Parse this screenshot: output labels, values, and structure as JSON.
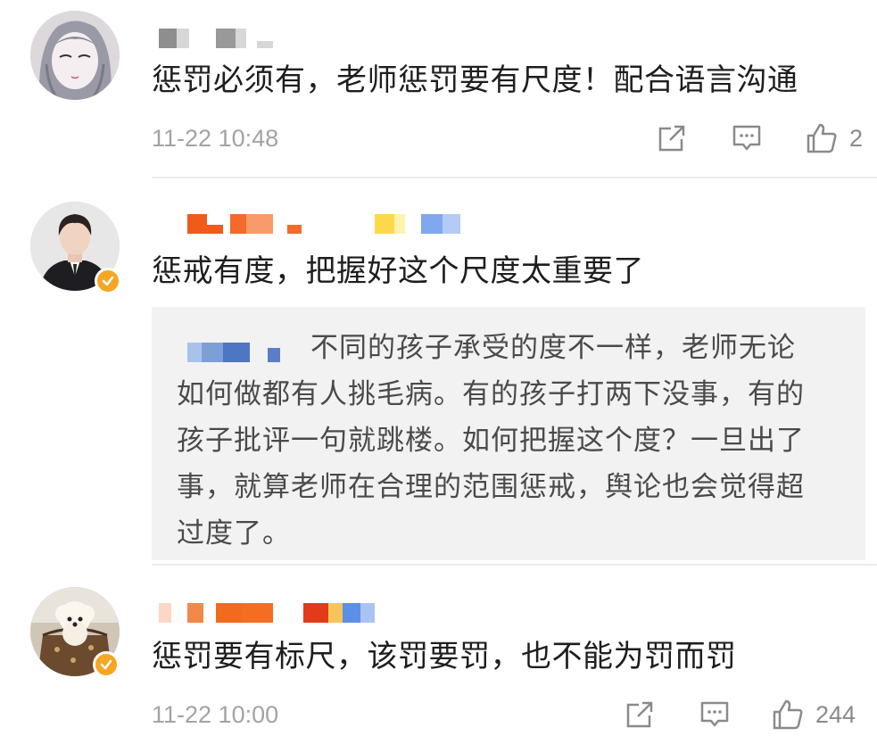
{
  "comments": [
    {
      "text": "惩罚必须有，老师惩罚要有尺度！配合语言沟通",
      "timestamp": "11-22 10:48",
      "likes": "2",
      "verified": false
    },
    {
      "text": "惩戒有度，把握好这个尺度太重要了",
      "verified": true,
      "reply": {
        "lines": [
          "不同的孩子承受的度不一样，老师无论",
          "如何做都有人挑毛病。有的孩子打两下没事，有的",
          "孩子批评一句就跳楼。如何把握这个度？一旦出了",
          "事，就算老师在合理的范围惩戒，舆论也会觉得超",
          "过度了。"
        ]
      }
    },
    {
      "text": "惩罚要有标尺，该罚要罚，也不能为罚而罚",
      "timestamp": "11-22 10:00",
      "likes": "244",
      "verified": true
    }
  ],
  "colors": {
    "verified_badge": "#f5a623",
    "timestamp": "#a3a3a3",
    "reply_bg": "#f2f2f2",
    "icon_stroke": "#8a8a8a"
  },
  "icons": {
    "share": "share-icon",
    "comment": "comment-icon",
    "like": "thumbs-up-icon",
    "verified": "verified-badge-icon"
  }
}
